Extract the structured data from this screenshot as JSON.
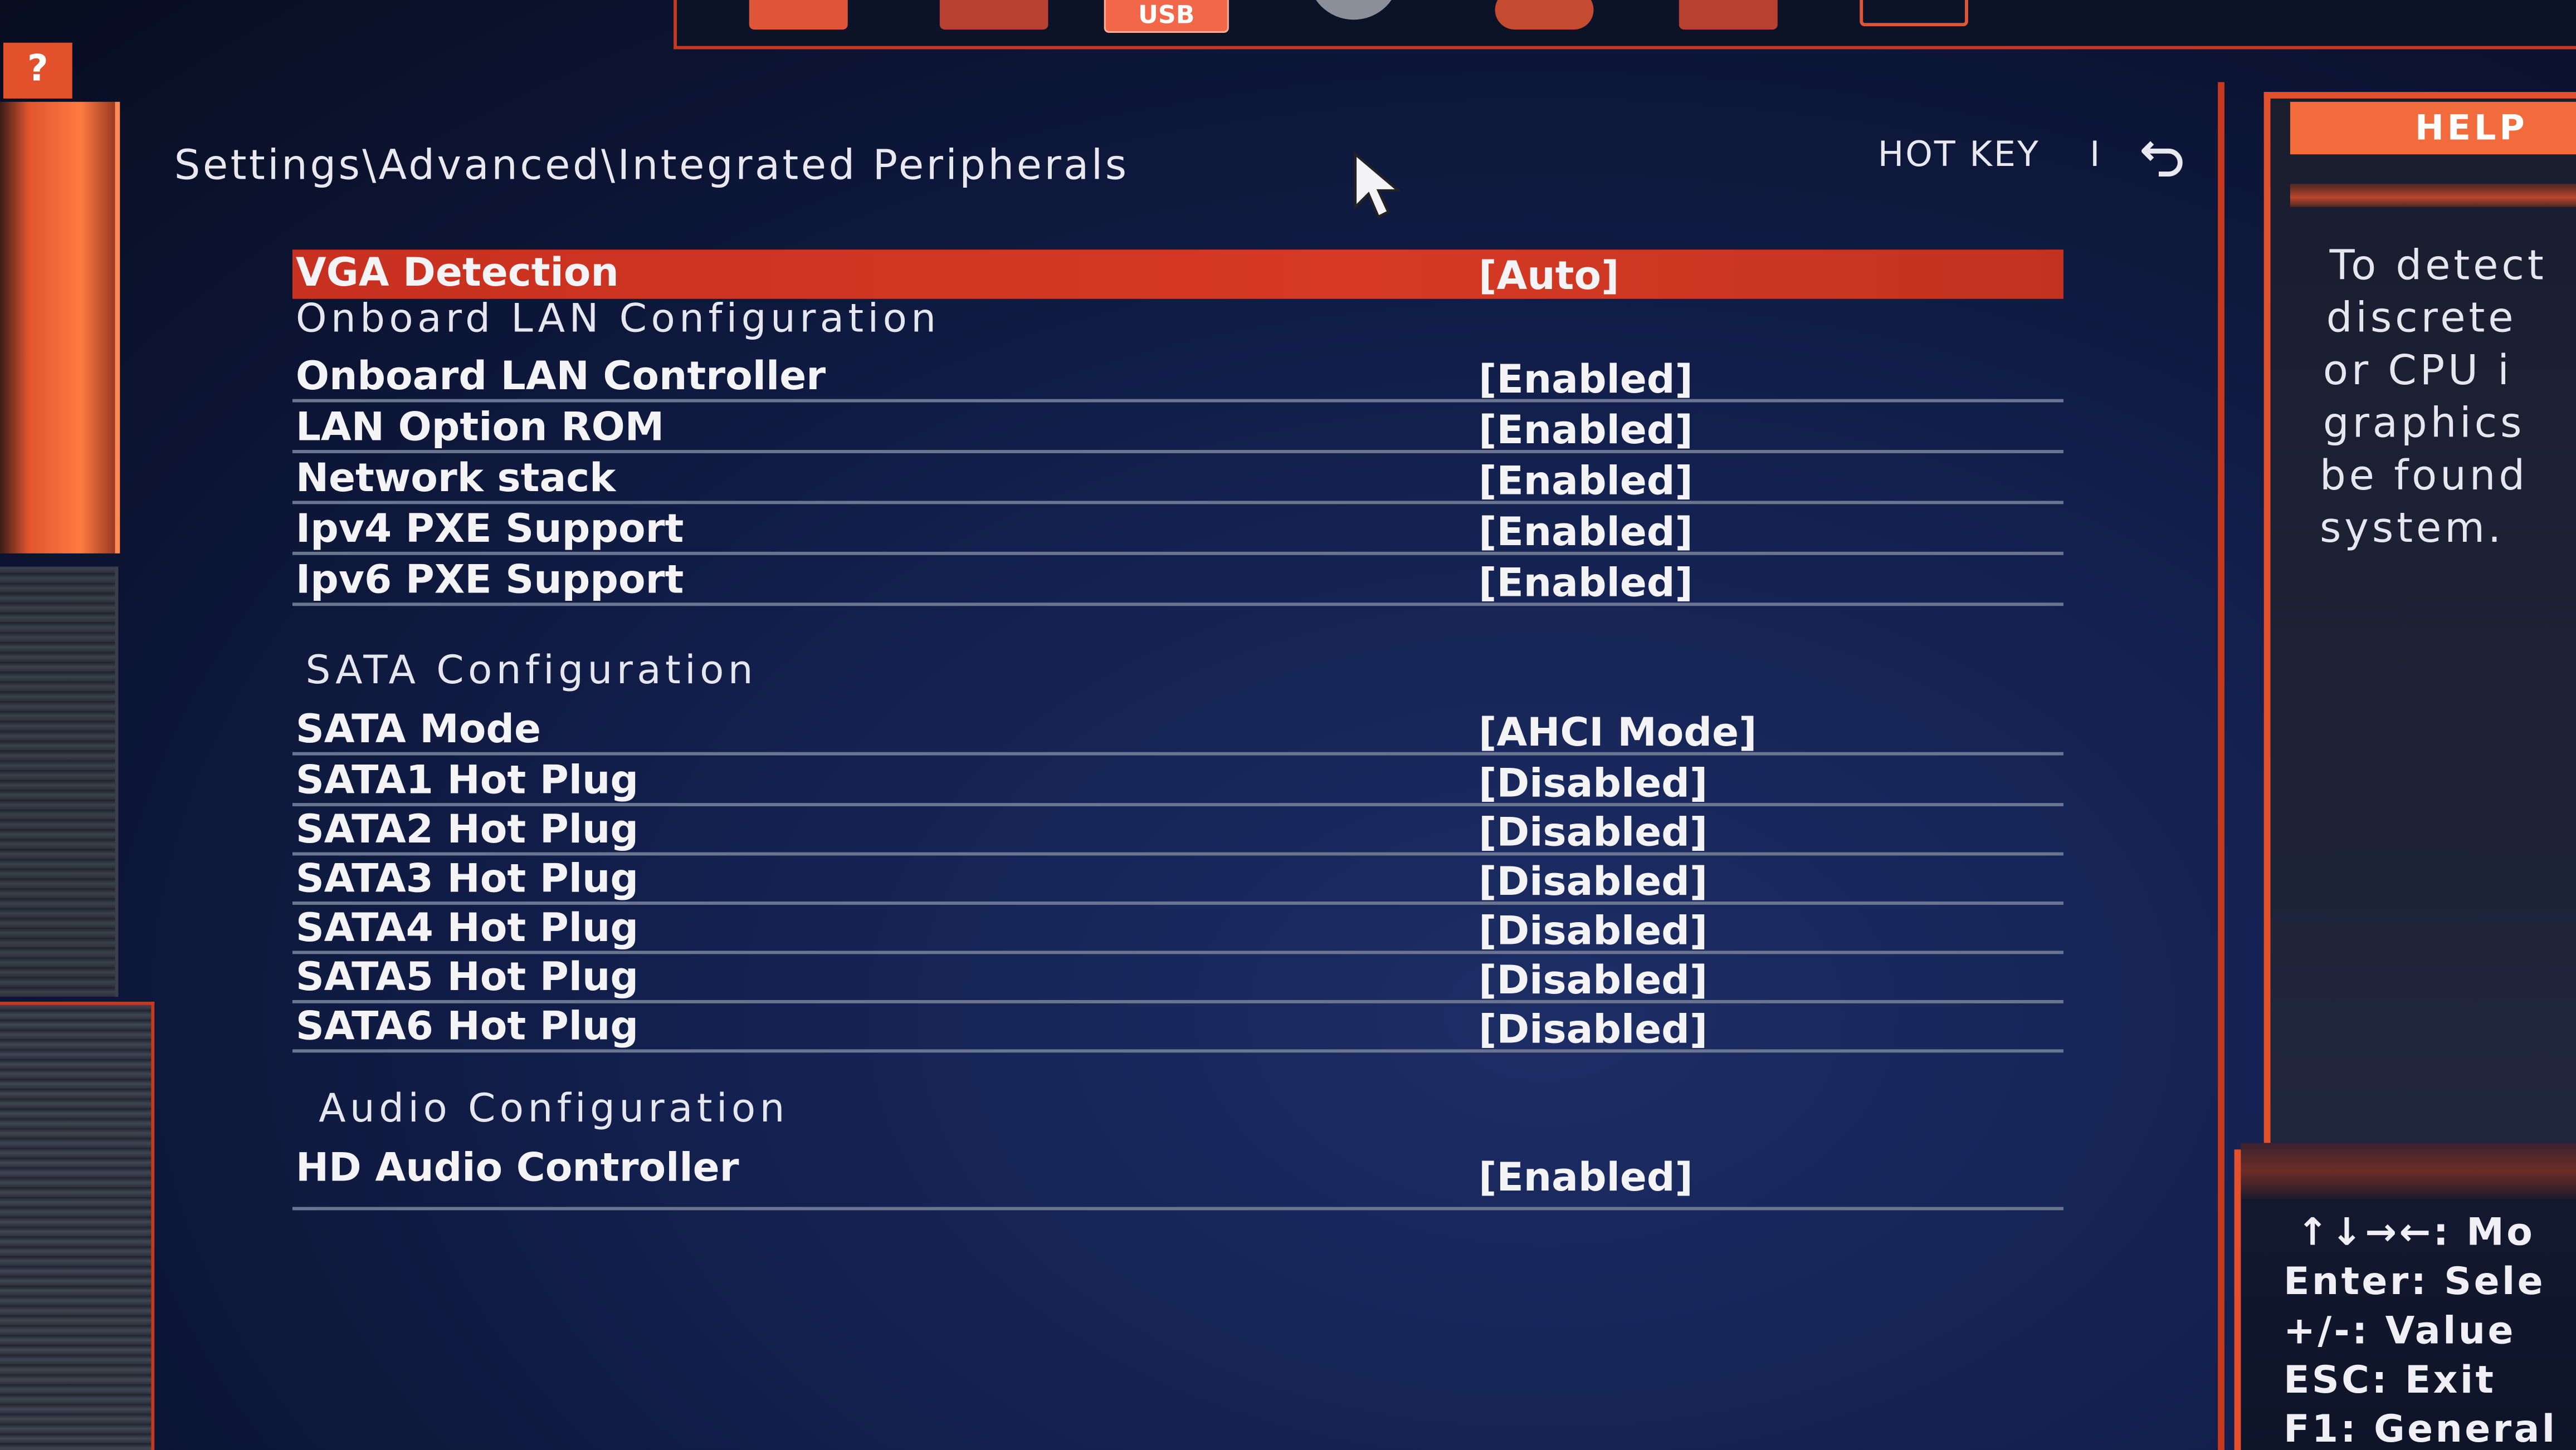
{
  "top_tabs": {
    "usb_label": "USB"
  },
  "help_badge": "?",
  "breadcrumb": "Settings\\Advanced\\Integrated Peripherals",
  "hotkey": {
    "label": "HOT KEY",
    "separator": "I"
  },
  "selected_item": {
    "label": "VGA Detection",
    "value": "[Auto]"
  },
  "sections": {
    "lan": "Onboard LAN Configuration",
    "sata": "SATA Configuration",
    "audio": "Audio Configuration"
  },
  "lan_items": [
    {
      "label": "Onboard LAN Controller",
      "value": "[Enabled]"
    },
    {
      "label": "LAN Option ROM",
      "value": "[Enabled]"
    },
    {
      "label": "Network stack",
      "value": "[Enabled]"
    },
    {
      "label": "Ipv4 PXE Support",
      "value": "[Enabled]"
    },
    {
      "label": "Ipv6 PXE Support",
      "value": "[Enabled]"
    }
  ],
  "sata_items": [
    {
      "label": "SATA Mode",
      "value": "[AHCI Mode]"
    },
    {
      "label": "SATA1 Hot Plug",
      "value": "[Disabled]"
    },
    {
      "label": "SATA2 Hot Plug",
      "value": "[Disabled]"
    },
    {
      "label": "SATA3 Hot Plug",
      "value": "[Disabled]"
    },
    {
      "label": "SATA4 Hot Plug",
      "value": "[Disabled]"
    },
    {
      "label": "SATA5 Hot Plug",
      "value": "[Disabled]"
    },
    {
      "label": "SATA6 Hot Plug",
      "value": "[Disabled]"
    }
  ],
  "audio_items": [
    {
      "label": "HD Audio Controller",
      "value": "[Enabled]"
    }
  ],
  "help_panel": {
    "title": "HELP",
    "lines": [
      "To detect",
      "discrete",
      "or CPU i",
      "graphics",
      "be found",
      "system."
    ]
  },
  "key_help": [
    "↑↓→←: Mo",
    "Enter: Sele",
    "+/-: Value",
    "ESC: Exit",
    "F1: General"
  ],
  "colors": {
    "accent": "#e2502c",
    "selected_row": "#d63a25",
    "background": "#132150"
  }
}
